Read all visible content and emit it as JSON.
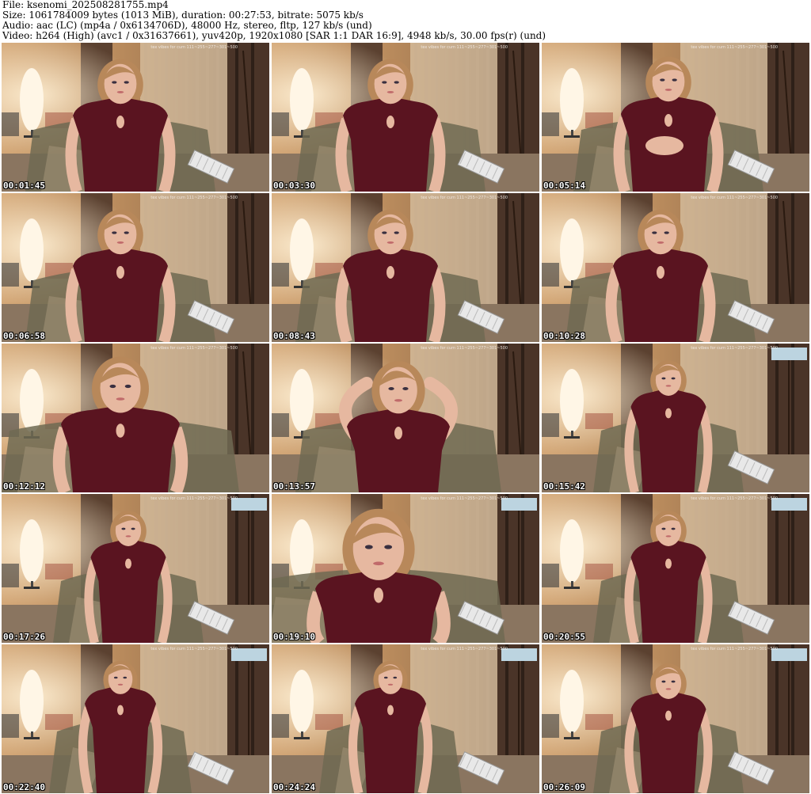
{
  "header": {
    "file": "File: ksenomi_202508281755.mp4",
    "size": "Size: 1061784009 bytes (1013 MiB), duration: 00:27:53, bitrate: 5075 kb/s",
    "audio": "Audio: aac (LC) (mp4a / 0x6134706D), 48000 Hz, stereo, fltp, 127 kb/s (und)",
    "video": "Video: h264 (High) (avc1 / 0x31637661), yuv420p, 1920x1080 [SAR 1:1 DAR 16:9], 4948 kb/s, 30.00 fps(r) (und)"
  },
  "overlay_text": "tex vibes for cum 111~255~277~301~500",
  "colors": {
    "wall": "#b88a5c",
    "curtain": "#4a3428",
    "lamp": "#fff6e6",
    "dress": "#5a1420",
    "skin": "#e6b8a0",
    "hair": "#b8885a",
    "couch": "#6e6a52"
  },
  "thumbnails": [
    {
      "time": "00:01:45",
      "pose": "centered"
    },
    {
      "time": "00:03:30",
      "pose": "centered"
    },
    {
      "time": "00:05:14",
      "pose": "hand-on-chest"
    },
    {
      "time": "00:06:58",
      "pose": "centered"
    },
    {
      "time": "00:08:43",
      "pose": "centered"
    },
    {
      "time": "00:10:28",
      "pose": "centered"
    },
    {
      "time": "00:12:12",
      "pose": "close"
    },
    {
      "time": "00:13:57",
      "pose": "hands-up"
    },
    {
      "time": "00:15:42",
      "pose": "far"
    },
    {
      "time": "00:17:26",
      "pose": "far"
    },
    {
      "time": "00:19:10",
      "pose": "leaning"
    },
    {
      "time": "00:20:55",
      "pose": "far"
    },
    {
      "time": "00:22:40",
      "pose": "standing"
    },
    {
      "time": "00:24:24",
      "pose": "standing"
    },
    {
      "time": "00:26:09",
      "pose": "sitting"
    }
  ]
}
